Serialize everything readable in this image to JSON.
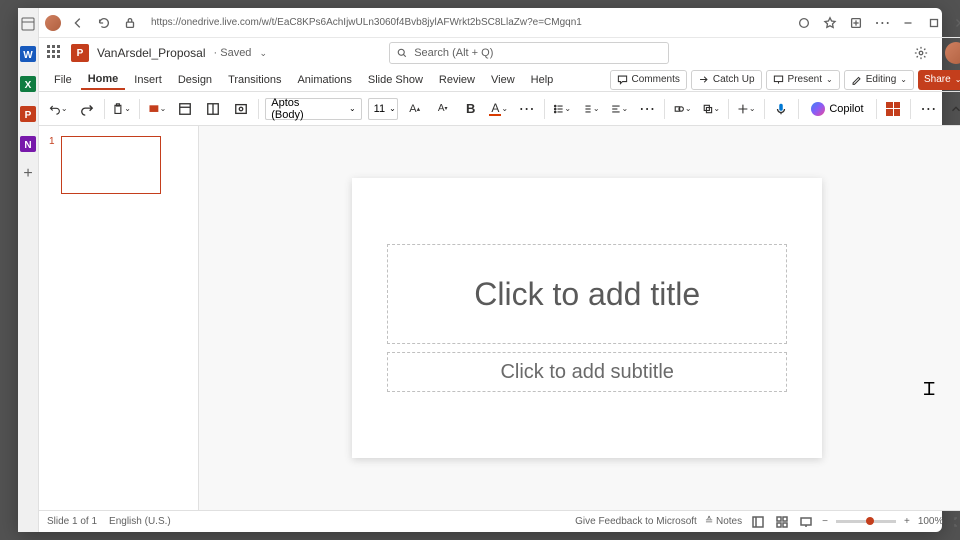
{
  "browser": {
    "url": "https://onedrive.live.com/w/t/EaC8KPs6AchIjwULn3060f4Bvb8jylAFWrkt2bSC8LlaZw?e=CMgqn1"
  },
  "header": {
    "doc_title": "VanArsdel_Proposal",
    "save_state": "· Saved",
    "search_placeholder": "Search (Alt + Q)"
  },
  "tabs": {
    "items": [
      "File",
      "Home",
      "Insert",
      "Design",
      "Transitions",
      "Animations",
      "Slide Show",
      "Review",
      "View",
      "Help"
    ],
    "comments": "Comments",
    "catchup": "Catch Up",
    "present": "Present",
    "editing": "Editing",
    "share": "Share"
  },
  "ribbon": {
    "font_family": "Aptos (Body)",
    "font_size": "11",
    "copilot": "Copilot"
  },
  "thumbs": {
    "num": "1"
  },
  "slide": {
    "title_ph": "Click to add title",
    "sub_ph": "Click to add subtitle"
  },
  "status": {
    "slide": "Slide 1 of 1",
    "lang": "English (U.S.)",
    "feedback": "Give Feedback to Microsoft",
    "notes": "Notes",
    "zoom": "100%"
  }
}
